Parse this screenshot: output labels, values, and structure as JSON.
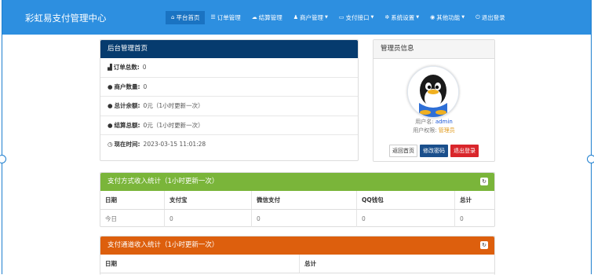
{
  "brand": "彩虹易支付管理中心",
  "nav": [
    {
      "icon": "home-icon",
      "glyph": "⌂",
      "label": "平台首页",
      "active": true,
      "caret": false
    },
    {
      "icon": "list-icon",
      "glyph": "☰",
      "label": "订单管理",
      "active": false,
      "caret": false
    },
    {
      "icon": "cloud-icon",
      "glyph": "☁",
      "label": "结算管理",
      "active": false,
      "caret": false
    },
    {
      "icon": "user-icon",
      "glyph": "♟",
      "label": "商户管理",
      "active": false,
      "caret": true
    },
    {
      "icon": "card-icon",
      "glyph": "▭",
      "label": "支付接口",
      "active": false,
      "caret": true
    },
    {
      "icon": "gear-icon",
      "glyph": "✲",
      "label": "系统设置",
      "active": false,
      "caret": true
    },
    {
      "icon": "globe-icon",
      "glyph": "◉",
      "label": "其他功能",
      "active": false,
      "caret": true
    },
    {
      "icon": "power-icon",
      "glyph": "⏻",
      "label": "退出登录",
      "active": false,
      "caret": false
    }
  ],
  "overview": {
    "title": "后台管理首页",
    "rows": [
      {
        "icon": "bar-chart-icon",
        "glyph": "▟",
        "label": "订单总数:",
        "value": "0"
      },
      {
        "icon": "drop-icon",
        "glyph": "●",
        "label": "商户数量:",
        "value": "0"
      },
      {
        "icon": "drop-icon",
        "glyph": "●",
        "label": "总计余额:",
        "value": "0元（1小时更新一次）"
      },
      {
        "icon": "drop-icon",
        "glyph": "●",
        "label": "结算总额:",
        "value": "0元（1小时更新一次）"
      },
      {
        "icon": "clock-icon",
        "glyph": "◷",
        "label": "现在时间:",
        "value": "2023-03-15 11:01:28"
      }
    ]
  },
  "admin": {
    "title": "管理员信息",
    "username_label": "用户名:",
    "username": "admin",
    "role_label": "用户权限:",
    "role": "管理员",
    "buttons": {
      "home": "返回首页",
      "password": "修改密码",
      "logout": "退出登录"
    }
  },
  "stats_pay_type": {
    "title": "支付方式收入统计（1小时更新一次）",
    "columns": [
      "日期",
      "支付宝",
      "微信支付",
      "QQ钱包",
      "总计"
    ],
    "rows": [
      [
        "今日",
        "0",
        "0",
        "0",
        "0"
      ]
    ]
  },
  "stats_channel": {
    "title": "支付通道收入统计（1小时更新一次）",
    "columns": [
      "日期",
      "总计"
    ]
  },
  "colors": {
    "navbar": "#2d8fe0",
    "overview_header": "#063b6e",
    "pay_type_header": "#7ab53a",
    "channel_header": "#dd5f0d"
  }
}
